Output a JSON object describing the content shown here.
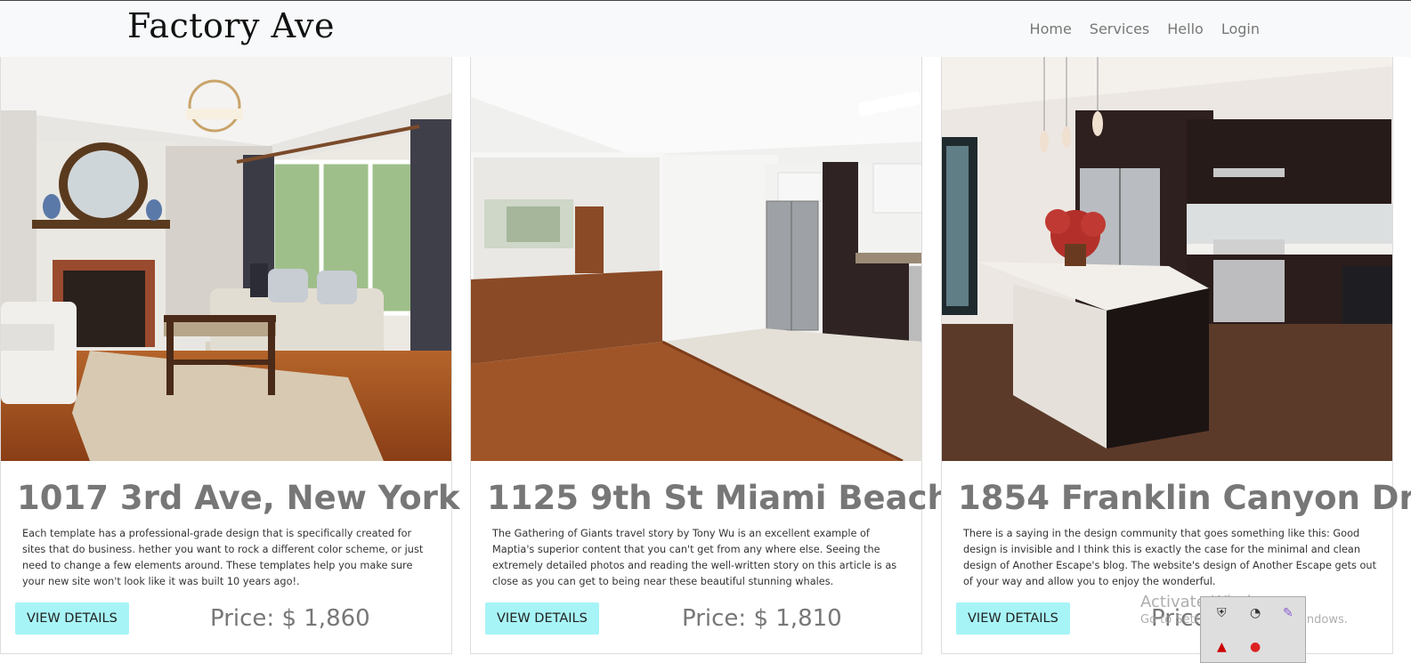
{
  "header": {
    "brand": "Factory Ave",
    "nav": [
      "Home",
      "Services",
      "Hello",
      "Login"
    ]
  },
  "listings": [
    {
      "title": "1017 3rd Ave, New York",
      "description": "Each template has a professional-grade design that is specifically created for sites that do business. hether you want to rock a different color scheme, or just need to change a few elements around. These templates help you make sure your new site won't look like it was built 10 years ago!.",
      "button": "VIEW DETAILS",
      "price": "Price: $ 1,860"
    },
    {
      "title": "1125 9th St Miami Beach",
      "description": "The Gathering of Giants travel story by Tony Wu is an excellent example of Maptia's superior content that you can't get from any where else. Seeing the extremely detailed photos and reading the well-written story on this article is as close as you can get to being near these beautiful stunning whales.",
      "button": "VIEW DETAILS",
      "price": "Price: $ 1,810"
    },
    {
      "title": "1854 Franklin Canyon Dr",
      "description": "There is a saying in the design community that goes something like this: Good design is invisible and I think this is exactly the case for the minimal and clean design of Another Escape's blog. The website's design of Another Escape gets out of your way and allow you to enjoy the wonderful.",
      "button": "VIEW DETAILS",
      "price": "Price"
    }
  ],
  "overlay": {
    "activate_title": "Activate Windows",
    "activate_sub": "Go to Settings to activate Windows."
  }
}
